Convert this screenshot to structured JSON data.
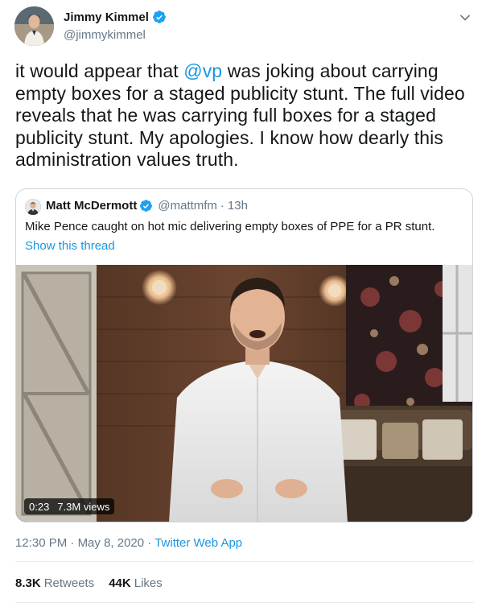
{
  "author": {
    "display_name": "Jimmy Kimmel",
    "handle": "@jimmykimmel",
    "avatar_icon": "avatar-photo",
    "verified_icon": "verified-badge-icon"
  },
  "tweet": {
    "text_before": "it would appear that ",
    "mention": "@vp",
    "text_after": " was joking about carrying empty boxes for a staged publicity stunt. The full video reveals that he was carrying full boxes for a staged publicity stunt. My apologies. I know how dearly this administration values truth."
  },
  "quote": {
    "display_name": "Matt McDermott",
    "handle": "@mattmfm",
    "separator": "·",
    "time": "13h",
    "text": "Mike Pence caught on hot mic delivering empty boxes of PPE for a PR stunt.",
    "show_thread": "Show this thread",
    "video": {
      "duration": "0:23",
      "views": "7.3M views"
    }
  },
  "meta": {
    "time": "12:30 PM",
    "sep1": " · ",
    "date": "May 8, 2020",
    "sep2": " · ",
    "source": "Twitter Web App"
  },
  "stats": {
    "retweets_count": "8.3K",
    "retweets_label": "Retweets",
    "likes_count": "44K",
    "likes_label": "Likes"
  },
  "colors": {
    "link": "#1b95e0",
    "text": "#14171a",
    "secondary": "#657786",
    "border": "#ccd6dd"
  }
}
